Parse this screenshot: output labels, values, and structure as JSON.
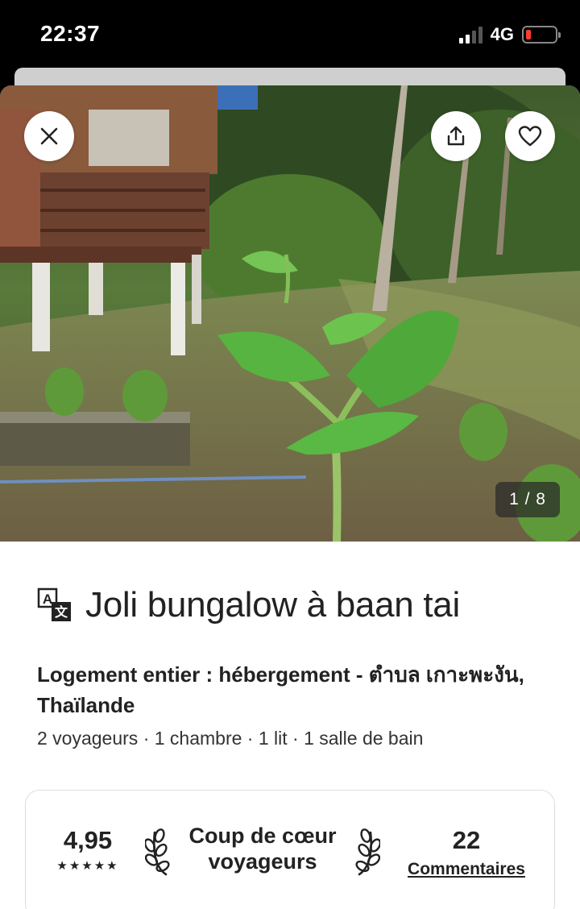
{
  "status_bar": {
    "time": "22:37",
    "network": "4G",
    "icons": [
      "signal-icon",
      "battery-low-icon"
    ]
  },
  "listing": {
    "photo": {
      "counter": "1 / 8",
      "description_icons": [
        "close-icon",
        "share-icon",
        "heart-icon"
      ]
    },
    "title": "Joli bungalow à baan tai",
    "subtitle": "Logement entier : hébergement - ตำบล เกาะพะงัน, Thaïlande",
    "details": "2 voyageurs · 1 chambre · 1 lit · 1 salle de bain",
    "highlight": {
      "rating": "4,95",
      "stars": "★★★★★",
      "badge": "Coup de cœur voyageurs",
      "reviews_count": "22",
      "reviews_label": "Commentaires"
    }
  },
  "colors": {
    "text": "#222222",
    "battery_low": "#ff3b30",
    "card_border": "#dddddd"
  }
}
